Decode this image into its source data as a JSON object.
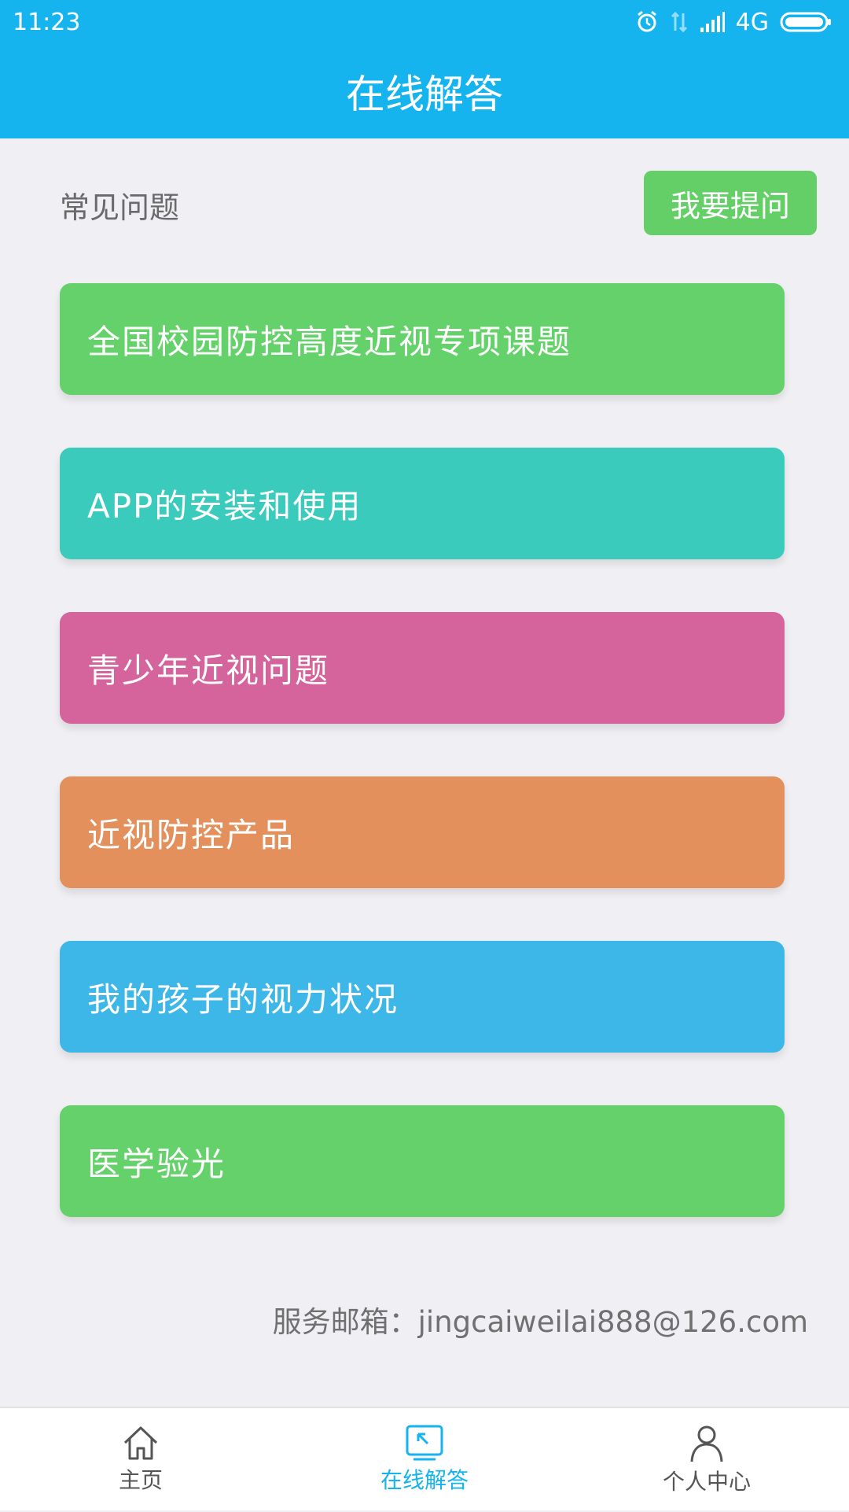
{
  "status_bar": {
    "time": "11:23",
    "network": "4G",
    "icons": [
      "alarm-icon",
      "data-arrows-icon",
      "signal-icon",
      "battery-icon"
    ]
  },
  "header": {
    "title": "在线解答"
  },
  "faq": {
    "section_title": "常见问题",
    "ask_button_label": "我要提问",
    "items": [
      {
        "label": "全国校园防控高度近视专项课题",
        "color": "#65d16a"
      },
      {
        "label": "APP的安装和使用",
        "color": "#3acbbd"
      },
      {
        "label": "青少年近视问题",
        "color": "#d5639c"
      },
      {
        "label": "近视防控产品",
        "color": "#e3905c"
      },
      {
        "label": "我的孩子的视力状况",
        "color": "#3db7e8"
      },
      {
        "label": "医学验光",
        "color": "#65d16a"
      }
    ]
  },
  "footer": {
    "email_text": "服务邮箱：jingcaiweilai888@126.com"
  },
  "bottom_nav": {
    "items": [
      {
        "label": "主页",
        "icon": "home-icon",
        "active": false
      },
      {
        "label": "在线解答",
        "icon": "answer-icon",
        "active": true
      },
      {
        "label": "个人中心",
        "icon": "person-icon",
        "active": false
      }
    ]
  },
  "colors": {
    "brand": "#16b4ef",
    "ask_button": "#63cf66",
    "background": "#f0f0f4"
  }
}
